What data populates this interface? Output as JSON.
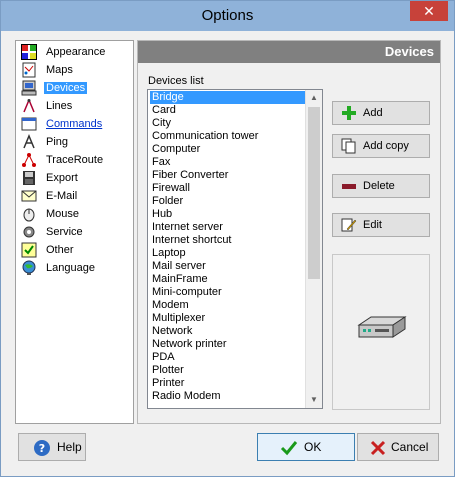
{
  "window": {
    "title": "Options",
    "close_glyph": "✕"
  },
  "nav": {
    "items": [
      {
        "label": "Appearance",
        "icon": "appearance-icon"
      },
      {
        "label": "Maps",
        "icon": "maps-icon"
      },
      {
        "label": "Devices",
        "icon": "devices-icon",
        "selected": true
      },
      {
        "label": "Lines",
        "icon": "lines-icon"
      },
      {
        "label": "Commands",
        "icon": "commands-icon",
        "link": true
      },
      {
        "label": "Ping",
        "icon": "ping-icon"
      },
      {
        "label": "TraceRoute",
        "icon": "traceroute-icon"
      },
      {
        "label": "Export",
        "icon": "export-icon"
      },
      {
        "label": "E-Mail",
        "icon": "email-icon"
      },
      {
        "label": "Mouse",
        "icon": "mouse-icon"
      },
      {
        "label": "Service",
        "icon": "service-icon"
      },
      {
        "label": "Other",
        "icon": "other-icon"
      },
      {
        "label": "Language",
        "icon": "language-icon"
      }
    ]
  },
  "panel": {
    "header": "Devices",
    "list_label": "Devices list",
    "devices": [
      "Bridge",
      "Card",
      "City",
      "Communication tower",
      "Computer",
      "Fax",
      "Fiber Converter",
      "Firewall",
      "Folder",
      "Hub",
      "Internet server",
      "Internet shortcut",
      "Laptop",
      "Mail server",
      "MainFrame",
      "Mini-computer",
      "Modem",
      "Multiplexer",
      "Network",
      "Network printer",
      "PDA",
      "Plotter",
      "Printer",
      "Radio Modem"
    ],
    "selected_device": "Bridge",
    "buttons": {
      "add": "Add",
      "add_copy": "Add copy",
      "delete": "Delete",
      "edit": "Edit"
    }
  },
  "footer": {
    "help": "Help",
    "ok": "OK",
    "cancel": "Cancel"
  },
  "colors": {
    "titlebar": "#8fb2d9",
    "close": "#c7423a",
    "selection": "#3399ff",
    "panel_header": "#808080"
  }
}
